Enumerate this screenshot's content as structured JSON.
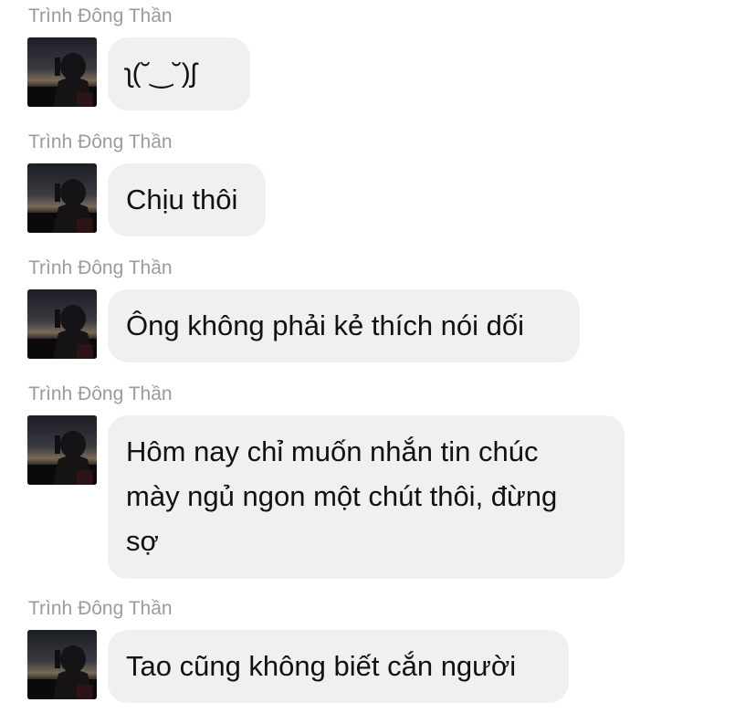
{
  "messages": [
    {
      "sender": "Trình Đông Thần",
      "text": "ʅ(˘‿˘)ʃ"
    },
    {
      "sender": "Trình Đông Thần",
      "text": "Chịu thôi"
    },
    {
      "sender": "Trình Đông Thần",
      "text": "Ông không phải kẻ thích nói dối"
    },
    {
      "sender": "Trình Đông Thần",
      "text": "Hôm nay chỉ muốn nhắn tin chúc\nmày ngủ ngon một chút thôi, đừng\nsợ"
    },
    {
      "sender": "Trình Đông Thần",
      "text": "Tao cũng không biết cắn người"
    }
  ],
  "colors": {
    "sender_name": "#9b9b9b",
    "bubble_bg": "#f0f0f0",
    "bubble_text": "#111111",
    "page_bg": "#ffffff"
  }
}
